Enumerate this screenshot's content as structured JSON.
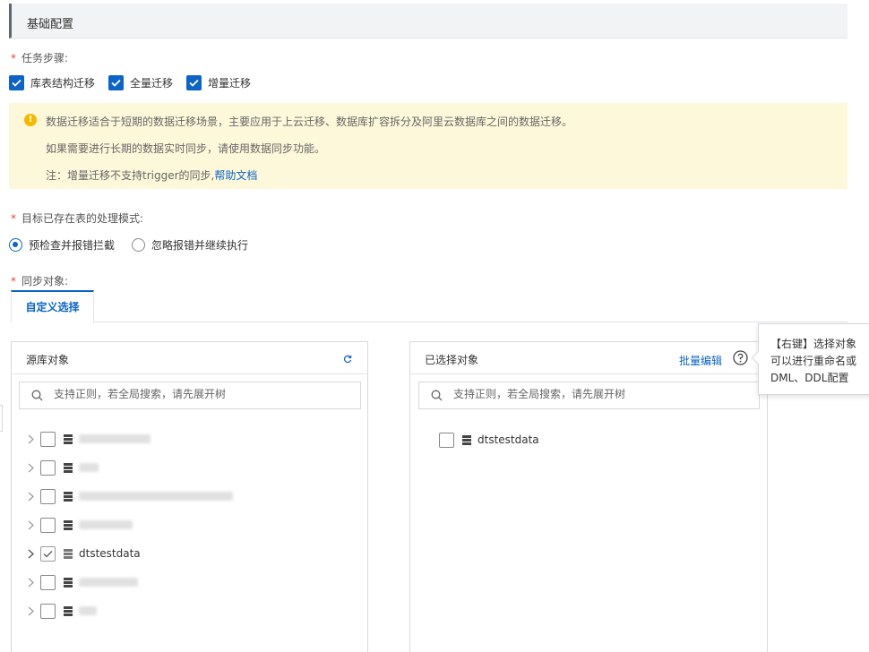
{
  "section": {
    "title": "基础配置"
  },
  "task_steps": {
    "label": "任务步骤:",
    "options": [
      {
        "label": "库表结构迁移",
        "checked": true
      },
      {
        "label": "全量迁移",
        "checked": true
      },
      {
        "label": "增量迁移",
        "checked": true
      }
    ]
  },
  "notice": {
    "icon": "warning-icon",
    "line1": "数据迁移适合于短期的数据迁移场景，主要应用于上云迁移、数据库扩容拆分及阿里云数据库之间的数据迁移。",
    "line2": "如果需要进行长期的数据实时同步，请使用数据同步功能。",
    "line3_prefix": "注：增量迁移不支持trigger的同步,",
    "line3_link": "帮助文档"
  },
  "existing_table_mode": {
    "label": "目标已存在表的处理模式:",
    "options": [
      {
        "label": "预检查并报错拦截",
        "selected": true
      },
      {
        "label": "忽略报错并继续执行",
        "selected": false
      }
    ]
  },
  "sync_objects": {
    "label": "同步对象:",
    "tabs": [
      {
        "label": "自定义选择",
        "active": true
      }
    ]
  },
  "source_panel": {
    "title": "源库对象",
    "search_placeholder": "支持正则，若全局搜索，请先展开树",
    "items": [
      {
        "name": "",
        "checked": false,
        "redacted": true
      },
      {
        "name": "",
        "checked": false,
        "redacted": true
      },
      {
        "name": "",
        "checked": false,
        "redacted": true
      },
      {
        "name": "",
        "checked": false,
        "redacted": true
      },
      {
        "name": "dtstestdata",
        "checked": true,
        "redacted": false
      },
      {
        "name": "",
        "checked": false,
        "redacted": true
      },
      {
        "name": "",
        "checked": false,
        "redacted": true
      }
    ]
  },
  "selected_panel": {
    "title": "已选择对象",
    "batch_edit": "批量编辑",
    "search_placeholder": "支持正则，若全局搜索，请先展开树",
    "items": [
      {
        "name": "dtstestdata",
        "checked": false
      }
    ]
  },
  "tooltip": {
    "line1": "【右键】选择对象",
    "line2": "可以进行重命名或",
    "line3": "DML、DDL配置"
  },
  "colors": {
    "accent": "#0b64c6",
    "notice_bg": "#fdf8da",
    "warning": "#f5b800",
    "required": "#e64545"
  }
}
